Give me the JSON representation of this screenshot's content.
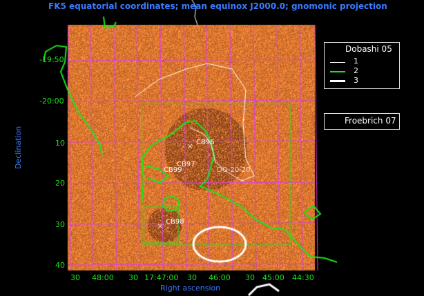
{
  "title": "FK5 equatorial coordinates; mean equinox J2000.0; gnomonic projection",
  "axes": {
    "ylabel": "Declination",
    "xlabel": "Right ascension",
    "yticks": [
      "-19:50",
      "-20:00",
      "10",
      "20",
      "30",
      "40"
    ],
    "xticks": [
      "30",
      "48:00",
      "30",
      "17:47:00",
      "30",
      "46:00",
      "30",
      "45:00",
      "44:30"
    ]
  },
  "legend": {
    "title": "Dobashi 05",
    "items": [
      {
        "label": "1",
        "color": "#ffffff"
      },
      {
        "label": "2",
        "color": "#19e619"
      },
      {
        "label": "3",
        "color": "#ffffff"
      }
    ]
  },
  "legend2": {
    "title": "Froebrich 07"
  },
  "objects": [
    "CB96",
    "CB97",
    "CB99",
    "CB98",
    "DO-20-20"
  ],
  "colors": {
    "title": "#3a7bff",
    "tick": "#19e619",
    "grid": "#e040e0",
    "contour_green": "#19e619",
    "background_dust": "#b5651d"
  }
}
